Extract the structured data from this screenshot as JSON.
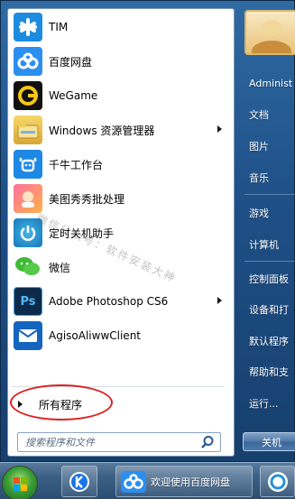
{
  "programs": [
    {
      "label": "TIM",
      "icon": "tim-icon",
      "arrow": false
    },
    {
      "label": "百度网盘",
      "icon": "baidu-netdisk-icon",
      "arrow": false
    },
    {
      "label": "WeGame",
      "icon": "wegame-icon",
      "arrow": false
    },
    {
      "label": "Windows 资源管理器",
      "icon": "file-explorer-icon",
      "arrow": true
    },
    {
      "label": "千牛工作台",
      "icon": "qianniu-icon",
      "arrow": false
    },
    {
      "label": "美图秀秀批处理",
      "icon": "meitu-icon",
      "arrow": false
    },
    {
      "label": "定时关机助手",
      "icon": "power-icon",
      "arrow": false
    },
    {
      "label": "微信",
      "icon": "wechat-icon",
      "arrow": false
    },
    {
      "label": "Adobe Photoshop CS6",
      "icon": "photoshop-icon",
      "arrow": true
    },
    {
      "label": "AgisoAliwwClient",
      "icon": "agiso-mail-icon",
      "arrow": false
    }
  ],
  "all_programs_label": "所有程序",
  "search": {
    "placeholder": "搜索程序和文件"
  },
  "right_pane": {
    "items": [
      "Administ",
      "文档",
      "图片",
      "音乐",
      "游戏",
      "计算机",
      "控制面板",
      "设备和打",
      "默认程序",
      "帮助和支",
      "运行..."
    ],
    "shutdown_label": "关机"
  },
  "watermark": "微信公众号：软件安装大神",
  "taskbar": {
    "active_window_label": "欢迎使用百度网盘"
  },
  "colors": {
    "menu_blue": "#1e4f86",
    "annotation_red": "#e0201f"
  }
}
